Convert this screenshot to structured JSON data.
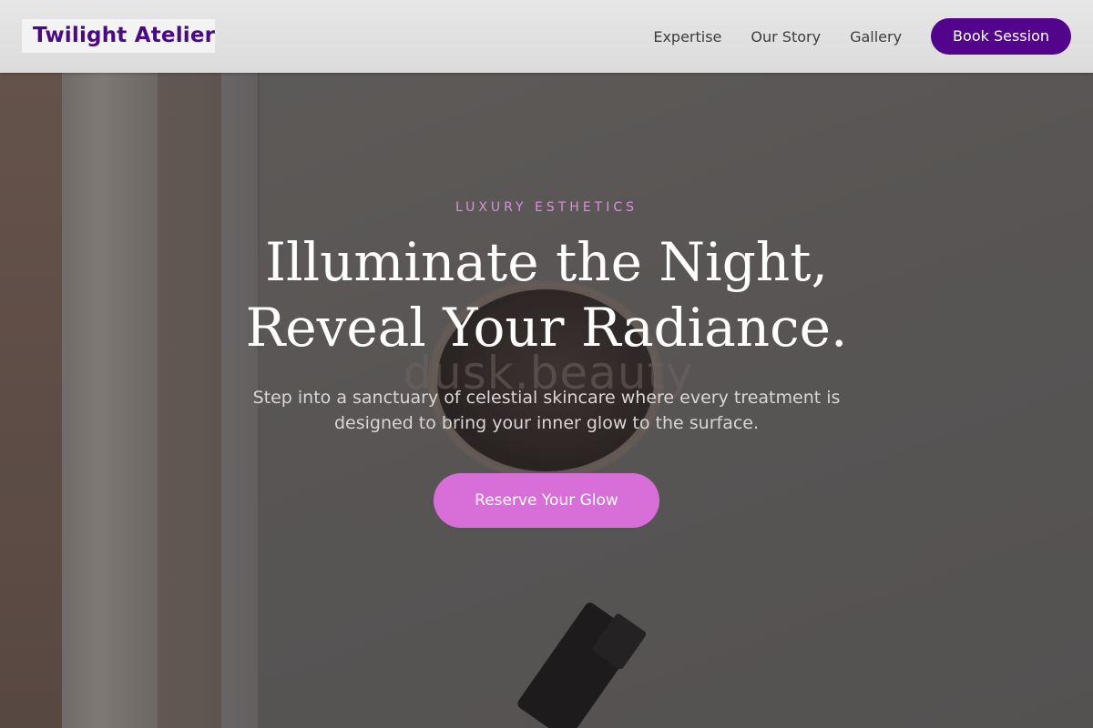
{
  "header": {
    "logo_text": "Twilight Atelier",
    "nav": {
      "expertise": "Expertise",
      "our_story": "Our Story",
      "gallery": "Gallery"
    },
    "cta_label": "Book Session"
  },
  "hero": {
    "eyebrow": "LUXURY ESTHETICS",
    "headline_line1": "Illuminate the Night,",
    "headline_line2": "Reveal Your Radiance.",
    "subtext_line1": "Step into a sanctuary of celestial skincare where every treatment is",
    "subtext_line2": "designed to bring your inner glow to the surface.",
    "cta_label": "Reserve Your Glow",
    "background_watermark": "dusk.beauty"
  },
  "colors": {
    "brand_purple": "#53048c",
    "logo_purple": "#4a0a82",
    "accent_pink": "#d86fd8",
    "eyebrow_pink": "#d98fd9",
    "header_bg": "#e0e0e0"
  }
}
